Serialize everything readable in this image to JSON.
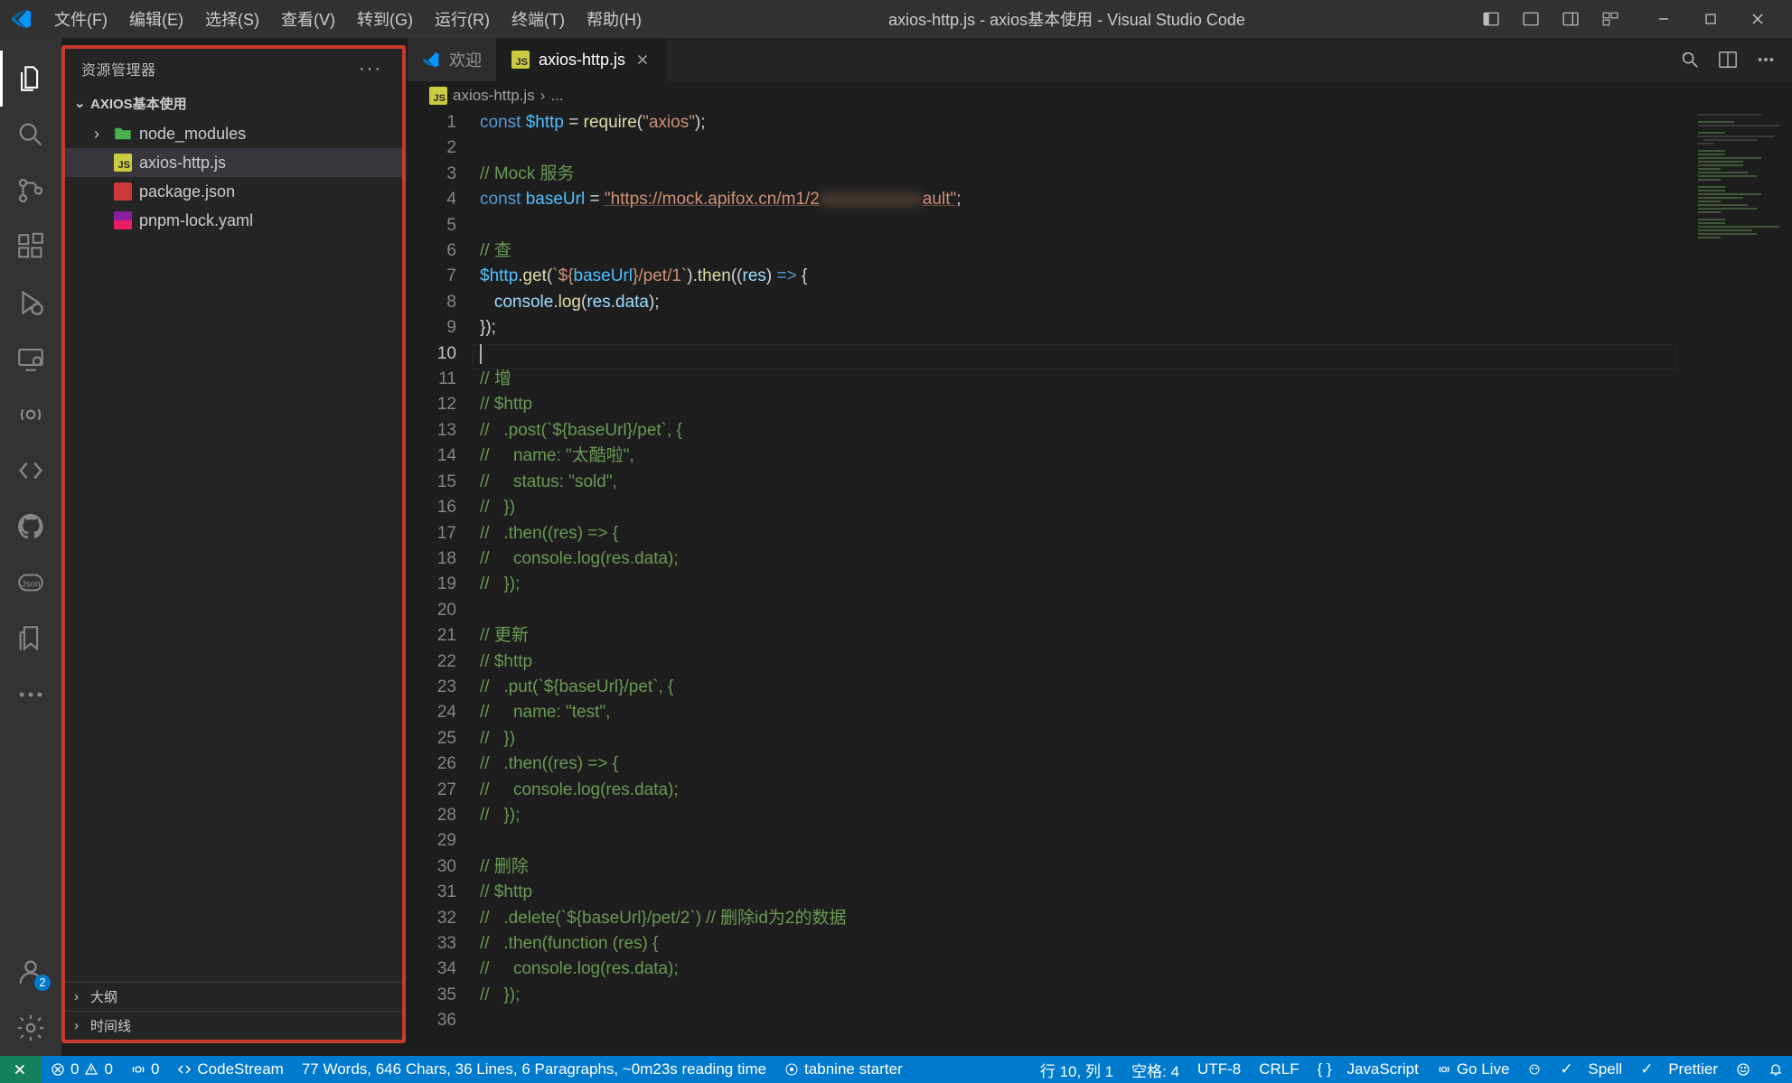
{
  "title": "axios-http.js - axios基本使用 - Visual Studio Code",
  "menu": [
    "文件(F)",
    "编辑(E)",
    "选择(S)",
    "查看(V)",
    "转到(G)",
    "运行(R)",
    "终端(T)",
    "帮助(H)"
  ],
  "sidebar": {
    "title": "资源管理器",
    "project": "AXIOS基本使用",
    "items": [
      {
        "name": "node_modules",
        "type": "folder",
        "chev": "›"
      },
      {
        "name": "axios-http.js",
        "type": "js",
        "selected": true
      },
      {
        "name": "package.json",
        "type": "npm"
      },
      {
        "name": "pnpm-lock.yaml",
        "type": "yaml"
      }
    ],
    "outline": "大纲",
    "timeline": "时间线"
  },
  "tabs": [
    {
      "label": "欢迎",
      "icon": "vscode",
      "active": false
    },
    {
      "label": "axios-http.js",
      "icon": "js",
      "active": true,
      "closable": true
    }
  ],
  "breadcrumb": {
    "file": "axios-http.js",
    "rest": "..."
  },
  "code": {
    "current_line": 10,
    "lines": [
      {
        "n": 1,
        "seg": [
          [
            "kw",
            "const "
          ],
          [
            "var",
            "$http"
          ],
          [
            "op",
            " = "
          ],
          [
            "fn",
            "require"
          ],
          [
            "pn",
            "("
          ],
          [
            "str",
            "\"axios\""
          ],
          [
            "pn",
            ");"
          ]
        ]
      },
      {
        "n": 2,
        "seg": []
      },
      {
        "n": 3,
        "seg": [
          [
            "cm",
            "// Mock 服务"
          ]
        ]
      },
      {
        "n": 4,
        "seg": [
          [
            "kw",
            "const "
          ],
          [
            "var",
            "baseUrl"
          ],
          [
            "op",
            " = "
          ],
          [
            "str url",
            "\"https://mock.apifox.cn/m1/2"
          ],
          [
            "str blur",
            "xxxxxxxxxxxx"
          ],
          [
            "str url",
            "ault\""
          ],
          [
            "pn",
            ";"
          ]
        ]
      },
      {
        "n": 5,
        "seg": []
      },
      {
        "n": 6,
        "seg": [
          [
            "cm",
            "// 查"
          ]
        ]
      },
      {
        "n": 7,
        "seg": [
          [
            "var",
            "$http"
          ],
          [
            "pn",
            "."
          ],
          [
            "fn",
            "get"
          ],
          [
            "pn",
            "("
          ],
          [
            "str",
            "`${"
          ],
          [
            "var",
            "baseUrl"
          ],
          [
            "str",
            "}/pet/1`"
          ],
          [
            "pn",
            ")."
          ],
          [
            "fn",
            "then"
          ],
          [
            "pn",
            "(("
          ],
          [
            "prm",
            "res"
          ],
          [
            "pn",
            ") "
          ],
          [
            "kw",
            "=>"
          ],
          [
            "pn",
            " {"
          ]
        ]
      },
      {
        "n": 8,
        "seg": [
          [
            "pn",
            "   "
          ],
          [
            "prm",
            "console"
          ],
          [
            "pn",
            "."
          ],
          [
            "fn",
            "log"
          ],
          [
            "pn",
            "("
          ],
          [
            "prm",
            "res"
          ],
          [
            "pn",
            "."
          ],
          [
            "prm",
            "data"
          ],
          [
            "pn",
            ");"
          ]
        ]
      },
      {
        "n": 9,
        "seg": [
          [
            "pn",
            "});"
          ]
        ]
      },
      {
        "n": 10,
        "seg": []
      },
      {
        "n": 11,
        "seg": [
          [
            "cm",
            "// 增"
          ]
        ]
      },
      {
        "n": 12,
        "seg": [
          [
            "cm",
            "// $http"
          ]
        ]
      },
      {
        "n": 13,
        "seg": [
          [
            "cm",
            "//   .post(`${baseUrl}/pet`, {"
          ]
        ]
      },
      {
        "n": 14,
        "seg": [
          [
            "cm",
            "//     name: \"太酷啦\","
          ]
        ]
      },
      {
        "n": 15,
        "seg": [
          [
            "cm",
            "//     status: \"sold\","
          ]
        ]
      },
      {
        "n": 16,
        "seg": [
          [
            "cm",
            "//   })"
          ]
        ]
      },
      {
        "n": 17,
        "seg": [
          [
            "cm",
            "//   .then((res) => {"
          ]
        ]
      },
      {
        "n": 18,
        "seg": [
          [
            "cm",
            "//     console.log(res.data);"
          ]
        ]
      },
      {
        "n": 19,
        "seg": [
          [
            "cm",
            "//   });"
          ]
        ]
      },
      {
        "n": 20,
        "seg": []
      },
      {
        "n": 21,
        "seg": [
          [
            "cm",
            "// 更新"
          ]
        ]
      },
      {
        "n": 22,
        "seg": [
          [
            "cm",
            "// $http"
          ]
        ]
      },
      {
        "n": 23,
        "seg": [
          [
            "cm",
            "//   .put(`${baseUrl}/pet`, {"
          ]
        ]
      },
      {
        "n": 24,
        "seg": [
          [
            "cm",
            "//     name: \"test\","
          ]
        ]
      },
      {
        "n": 25,
        "seg": [
          [
            "cm",
            "//   })"
          ]
        ]
      },
      {
        "n": 26,
        "seg": [
          [
            "cm",
            "//   .then((res) => {"
          ]
        ]
      },
      {
        "n": 27,
        "seg": [
          [
            "cm",
            "//     console.log(res.data);"
          ]
        ]
      },
      {
        "n": 28,
        "seg": [
          [
            "cm",
            "//   });"
          ]
        ]
      },
      {
        "n": 29,
        "seg": []
      },
      {
        "n": 30,
        "seg": [
          [
            "cm",
            "// 删除"
          ]
        ]
      },
      {
        "n": 31,
        "seg": [
          [
            "cm",
            "// $http"
          ]
        ]
      },
      {
        "n": 32,
        "seg": [
          [
            "cm",
            "//   .delete(`${baseUrl}/pet/2`) // 删除id为2的数据"
          ]
        ]
      },
      {
        "n": 33,
        "seg": [
          [
            "cm",
            "//   .then(function (res) {"
          ]
        ]
      },
      {
        "n": 34,
        "seg": [
          [
            "cm",
            "//     console.log(res.data);"
          ]
        ]
      },
      {
        "n": 35,
        "seg": [
          [
            "cm",
            "//   });"
          ]
        ]
      },
      {
        "n": 36,
        "seg": []
      }
    ]
  },
  "status": {
    "errors": "0",
    "warnings": "0",
    "port": "0",
    "codestream": "CodeStream",
    "stats": "77 Words, 646 Chars, 36 Lines, 6 Paragraphs, ~0m23s reading time",
    "tabnine": "tabnine starter",
    "cursor": "行 10, 列 1",
    "spaces": "空格: 4",
    "encoding": "UTF-8",
    "eol": "CRLF",
    "lang": "JavaScript",
    "golive": "Go Live",
    "spell": "Spell",
    "prettier": "Prettier"
  },
  "account_badge": "2"
}
